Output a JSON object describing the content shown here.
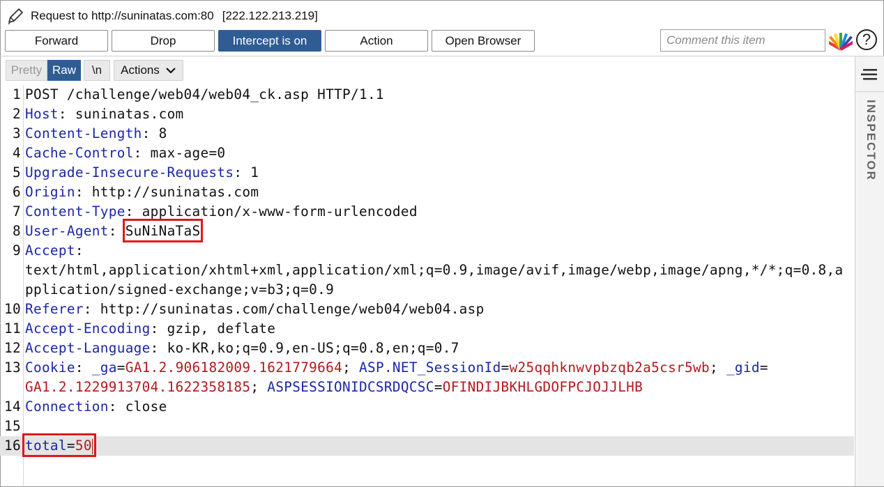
{
  "window": {
    "title": "Request to http://suninatas.com:80",
    "ip": "[222.122.213.219]"
  },
  "toolbar": {
    "forward": "Forward",
    "drop": "Drop",
    "intercept": "Intercept is on",
    "action": "Action",
    "open_browser": "Open Browser",
    "comment_placeholder": "Comment this item",
    "help": "?"
  },
  "editor_tabs": {
    "pretty": "Pretty",
    "raw": "Raw",
    "newline": "\\n",
    "actions": "Actions",
    "active": "Raw"
  },
  "inspector": {
    "label": "INSPECTOR"
  },
  "colors": {
    "header_name": "#1a26a8",
    "cookie_value": "#b3191c",
    "highlight_box": "#e01818",
    "active_button": "#2f5d93"
  },
  "request": {
    "lines": [
      {
        "n": "1",
        "parts": [
          {
            "t": "POST /challenge/web04/web04_ck.asp HTTP/1.1",
            "c": "v"
          }
        ]
      },
      {
        "n": "2",
        "parts": [
          {
            "t": "Host",
            "c": "k"
          },
          {
            "t": ": suninatas.com",
            "c": "v"
          }
        ]
      },
      {
        "n": "3",
        "parts": [
          {
            "t": "Content-Length",
            "c": "k"
          },
          {
            "t": ": 8",
            "c": "v"
          }
        ]
      },
      {
        "n": "4",
        "parts": [
          {
            "t": "Cache-Control",
            "c": "k"
          },
          {
            "t": ": max-age=0",
            "c": "v"
          }
        ]
      },
      {
        "n": "5",
        "parts": [
          {
            "t": "Upgrade-Insecure-Requests",
            "c": "k"
          },
          {
            "t": ": 1",
            "c": "v"
          }
        ]
      },
      {
        "n": "6",
        "parts": [
          {
            "t": "Origin",
            "c": "k"
          },
          {
            "t": ": http://suninatas.com",
            "c": "v"
          }
        ]
      },
      {
        "n": "7",
        "parts": [
          {
            "t": "Content-Type",
            "c": "k"
          },
          {
            "t": ": application/x-www-form-urlencoded",
            "c": "v"
          }
        ]
      },
      {
        "n": "8",
        "parts": [
          {
            "t": "User-Agent",
            "c": "k"
          },
          {
            "t": ": ",
            "c": "v"
          },
          {
            "t": "SuNiNaTaS",
            "c": "v",
            "box": true
          }
        ]
      },
      {
        "n": "9",
        "parts": [
          {
            "t": "Accept",
            "c": "k"
          },
          {
            "t": ":",
            "c": "v"
          }
        ]
      },
      {
        "n": "",
        "parts": [
          {
            "t": "text/html,application/xhtml+xml,application/xml;q=0.9,image/avif,image/webp,image/apng,*/*;q=0.8,a",
            "c": "v"
          }
        ]
      },
      {
        "n": "",
        "parts": [
          {
            "t": "pplication/signed-exchange;v=b3;q=0.9",
            "c": "v"
          }
        ]
      },
      {
        "n": "10",
        "parts": [
          {
            "t": "Referer",
            "c": "k"
          },
          {
            "t": ": http://suninatas.com/challenge/web04/web04.asp",
            "c": "v"
          }
        ]
      },
      {
        "n": "11",
        "parts": [
          {
            "t": "Accept-Encoding",
            "c": "k"
          },
          {
            "t": ": gzip, deflate",
            "c": "v"
          }
        ]
      },
      {
        "n": "12",
        "parts": [
          {
            "t": "Accept-Language",
            "c": "k"
          },
          {
            "t": ": ko-KR,ko;q=0.9,en-US;q=0.8,en;q=0.7",
            "c": "v"
          }
        ]
      },
      {
        "n": "13",
        "parts": [
          {
            "t": "Cookie",
            "c": "k"
          },
          {
            "t": ": ",
            "c": "v"
          },
          {
            "t": "_ga",
            "c": "k"
          },
          {
            "t": "=",
            "c": "v"
          },
          {
            "t": "GA1.2.906182009.1621779664",
            "c": "r"
          },
          {
            "t": "; ",
            "c": "v"
          },
          {
            "t": "ASP.NET_SessionId",
            "c": "k"
          },
          {
            "t": "=",
            "c": "v"
          },
          {
            "t": "w25qqhknwvpbzqb2a5csr5wb",
            "c": "r"
          },
          {
            "t": "; ",
            "c": "v"
          },
          {
            "t": "_gid",
            "c": "k"
          },
          {
            "t": "=",
            "c": "v"
          }
        ]
      },
      {
        "n": "",
        "parts": [
          {
            "t": "GA1.2.1229913704.1622358185",
            "c": "r"
          },
          {
            "t": "; ",
            "c": "v"
          },
          {
            "t": "ASPSESSIONIDCSRDQCSC",
            "c": "k"
          },
          {
            "t": "=",
            "c": "v"
          },
          {
            "t": "OFINDIJBKHLGDOFPCJOJJLHB",
            "c": "r"
          }
        ]
      },
      {
        "n": "14",
        "parts": [
          {
            "t": "Connection",
            "c": "k"
          },
          {
            "t": ": close",
            "c": "v"
          }
        ]
      },
      {
        "n": "15",
        "parts": []
      },
      {
        "n": "16",
        "parts": [
          {
            "t": "total",
            "c": "k",
            "boxstart": true
          },
          {
            "t": "=",
            "c": "v"
          },
          {
            "t": "50",
            "c": "r",
            "boxend": true,
            "caret": true
          }
        ],
        "current": true
      }
    ]
  }
}
